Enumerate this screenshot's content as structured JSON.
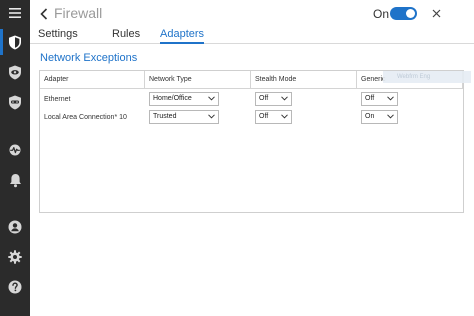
{
  "sidebar": {
    "items": [
      {
        "icon": "menu-icon"
      },
      {
        "icon": "shield-icon"
      },
      {
        "icon": "shield-eye-icon"
      },
      {
        "icon": "shield-mask-icon"
      },
      {
        "icon": "pulse-icon"
      },
      {
        "icon": "bell-icon"
      },
      {
        "icon": "account-icon"
      },
      {
        "icon": "gear-icon"
      },
      {
        "icon": "help-icon"
      }
    ]
  },
  "header": {
    "title": "Firewall",
    "toggle_label": "On",
    "toggle_on": true
  },
  "tabs": [
    {
      "label": "Settings"
    },
    {
      "label": "Rules"
    },
    {
      "label": "Adapters"
    }
  ],
  "section": {
    "title": "Network Exceptions"
  },
  "table": {
    "headers": [
      "Adapter",
      "Network Type",
      "Stealth Mode",
      "Generic"
    ],
    "rows": [
      {
        "adapter": "Ethernet",
        "network_type": "Home/Office",
        "stealth_mode": "Off",
        "generic": "Off"
      },
      {
        "adapter": "Local Area Connection* 10",
        "network_type": "Trusted",
        "stealth_mode": "Off",
        "generic": "On"
      }
    ]
  },
  "ghost_tooltip": "Webfrm Eng",
  "colors": {
    "accent": "#1f73c9",
    "sidebar_bg": "#2b2b2b"
  }
}
